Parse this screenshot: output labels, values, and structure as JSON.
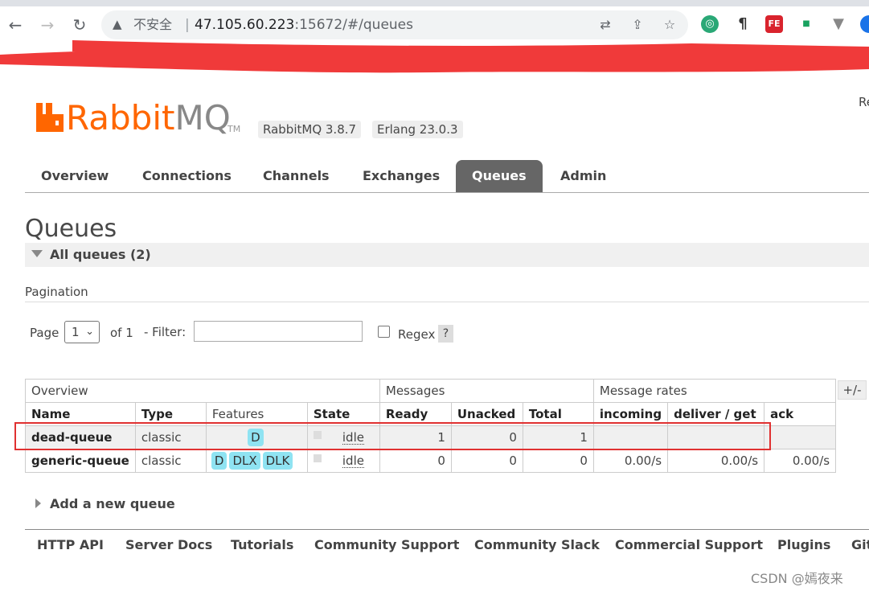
{
  "browser": {
    "insecure_label": "不安全",
    "separator": "|",
    "url_host": "47.105.60.223",
    "url_rest": ":15672/#/queues"
  },
  "icons": {
    "back": "back-arrow-icon",
    "forward": "forward-arrow-icon",
    "reload": "reload-icon",
    "warning": "warning-triangle-icon",
    "translate": "translate-icon",
    "share": "share-icon",
    "bookmark": "star-icon"
  },
  "extensions": {
    "pilcrow": "¶",
    "fe": "FE"
  },
  "header": {
    "logo_rabbit": "Rabbit",
    "logo_mq": "MQ",
    "logo_tm": "TM",
    "version": "RabbitMQ 3.8.7",
    "erlang": "Erlang 23.0.3",
    "user_partial": "Re"
  },
  "tabs": [
    {
      "label": "Overview"
    },
    {
      "label": "Connections"
    },
    {
      "label": "Channels"
    },
    {
      "label": "Exchanges"
    },
    {
      "label": "Queues",
      "active": true
    },
    {
      "label": "Admin"
    }
  ],
  "page": {
    "title": "Queues",
    "section_title": "All queues (2)",
    "pagination_label": "Pagination",
    "page_label": "Page",
    "page_value": "1",
    "of_label": "of 1",
    "filter_label": "- Filter:",
    "filter_value": "",
    "regex_label": "Regex",
    "help_label": "?",
    "plus_minus": "+/-",
    "add_queue": "Add a new queue"
  },
  "table": {
    "groups": [
      "Overview",
      "Messages",
      "Message rates"
    ],
    "columns": [
      "Name",
      "Type",
      "Features",
      "State",
      "Ready",
      "Unacked",
      "Total",
      "incoming",
      "deliver / get",
      "ack"
    ],
    "rows": [
      {
        "name": "dead-queue",
        "type": "classic",
        "features": [
          "D"
        ],
        "state": "idle",
        "ready": "1",
        "unacked": "0",
        "total": "1",
        "incoming": "",
        "deliver": "",
        "ack": ""
      },
      {
        "name": "generic-queue",
        "type": "classic",
        "features": [
          "D",
          "DLX",
          "DLK"
        ],
        "state": "idle",
        "ready": "0",
        "unacked": "0",
        "total": "0",
        "incoming": "0.00/s",
        "deliver": "0.00/s",
        "ack": "0.00/s"
      }
    ]
  },
  "footer": [
    "HTTP API",
    "Server Docs",
    "Tutorials",
    "Community Support",
    "Community Slack",
    "Commercial Support",
    "Plugins",
    "Git"
  ],
  "watermark": "CSDN @嫣夜来",
  "colors": {
    "brand_orange": "#ff6600",
    "feature_badge": "#8fe3f2",
    "highlight": "#e03131"
  }
}
